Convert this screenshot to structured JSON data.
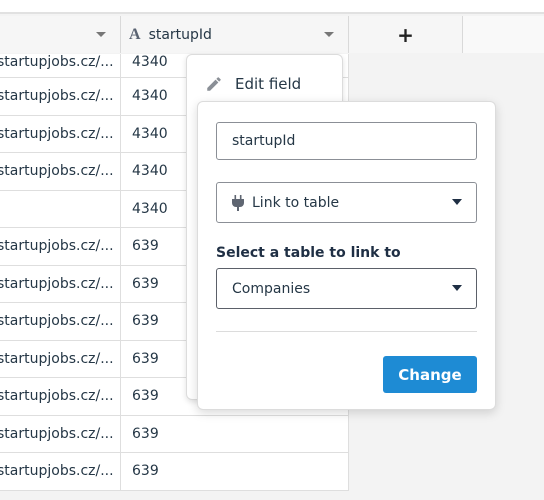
{
  "header": {
    "col_url_label": "",
    "col_id_label": "startupId",
    "col_id_type_icon": "text-type-icon",
    "add_column_label": "+"
  },
  "rows": [
    {
      "url": "startupjobs.cz/...",
      "id": "4340"
    },
    {
      "url": "startupjobs.cz/...",
      "id": "4340"
    },
    {
      "url": "startupjobs.cz/...",
      "id": "4340"
    },
    {
      "url": "startupjobs.cz/...",
      "id": "4340"
    },
    {
      "url": "",
      "id": "4340"
    },
    {
      "url": "startupjobs.cz/...",
      "id": "639"
    },
    {
      "url": "startupjobs.cz/...",
      "id": "639"
    },
    {
      "url": "startupjobs.cz/...",
      "id": "639"
    },
    {
      "url": "startupjobs.cz/...",
      "id": "639"
    },
    {
      "url": "startupjobs.cz/...",
      "id": "639"
    },
    {
      "url": "startupjobs.cz/...",
      "id": "639"
    },
    {
      "url": "startupjobs.cz/...",
      "id": "639"
    }
  ],
  "context_menu": {
    "edit_field_label": "Edit field"
  },
  "edit_panel": {
    "field_name_value": "startupId",
    "field_type_value": "Link to table",
    "select_table_label": "Select a table to link to",
    "table_value": "Companies",
    "change_button_label": "Change"
  },
  "colors": {
    "accent": "#1e8bd4",
    "text": "#253746"
  }
}
